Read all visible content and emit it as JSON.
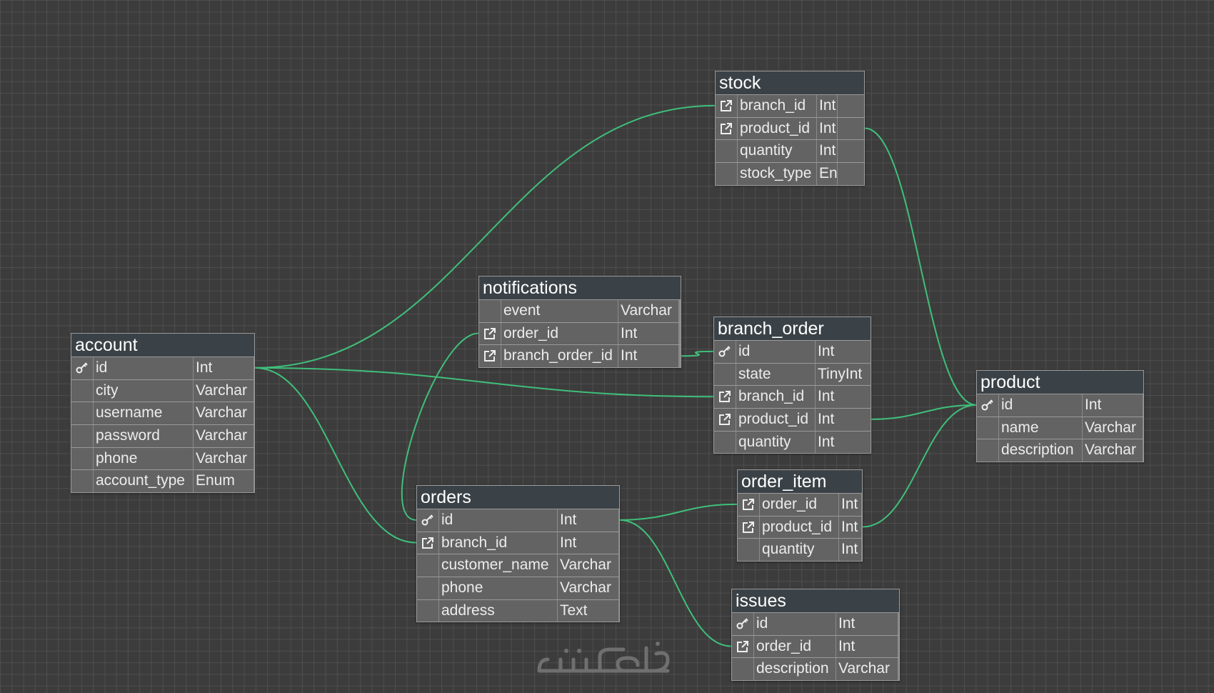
{
  "colors": {
    "link": "#3fbf7a",
    "header": "#3b4247",
    "cell": "#636363",
    "background": "#3c3c3c"
  },
  "watermark": {
    "text": "خمسات"
  },
  "tables": [
    {
      "id": "stock",
      "title": "stock",
      "rows": [
        {
          "icon": "foreign-key-icon",
          "name": "branch_id",
          "type": "Int"
        },
        {
          "icon": "foreign-key-icon",
          "name": "product_id",
          "type": "Int"
        },
        {
          "icon": "",
          "name": "quantity",
          "type": "Int"
        },
        {
          "icon": "",
          "name": "stock_type",
          "type": "Enum"
        }
      ]
    },
    {
      "id": "notifications",
      "title": "notifications",
      "rows": [
        {
          "icon": "",
          "name": "event",
          "type": "Varchar"
        },
        {
          "icon": "foreign-key-icon",
          "name": "order_id",
          "type": "Int"
        },
        {
          "icon": "foreign-key-icon",
          "name": "branch_order_id",
          "type": "Int"
        }
      ]
    },
    {
      "id": "branch_order",
      "title": "branch_order",
      "rows": [
        {
          "icon": "primary-key-icon",
          "name": "id",
          "type": "Int"
        },
        {
          "icon": "",
          "name": "state",
          "type": "TinyInt"
        },
        {
          "icon": "foreign-key-icon",
          "name": "branch_id",
          "type": "Int"
        },
        {
          "icon": "foreign-key-icon",
          "name": "product_id",
          "type": "Int"
        },
        {
          "icon": "",
          "name": "quantity",
          "type": "Int"
        }
      ]
    },
    {
      "id": "account",
      "title": "account",
      "rows": [
        {
          "icon": "primary-key-icon",
          "name": "id",
          "type": "Int"
        },
        {
          "icon": "",
          "name": "city",
          "type": "Varchar"
        },
        {
          "icon": "",
          "name": "username",
          "type": "Varchar"
        },
        {
          "icon": "",
          "name": "password",
          "type": "Varchar"
        },
        {
          "icon": "",
          "name": "phone",
          "type": "Varchar"
        },
        {
          "icon": "",
          "name": "account_type",
          "type": "Enum"
        }
      ]
    },
    {
      "id": "product",
      "title": "product",
      "rows": [
        {
          "icon": "primary-key-icon",
          "name": "id",
          "type": "Int"
        },
        {
          "icon": "",
          "name": "name",
          "type": "Varchar"
        },
        {
          "icon": "",
          "name": "description",
          "type": "Varchar"
        }
      ]
    },
    {
      "id": "order_item",
      "title": "order_item",
      "rows": [
        {
          "icon": "foreign-key-icon",
          "name": "order_id",
          "type": "Int"
        },
        {
          "icon": "foreign-key-icon",
          "name": "product_id",
          "type": "Int"
        },
        {
          "icon": "",
          "name": "quantity",
          "type": "Int"
        }
      ]
    },
    {
      "id": "orders",
      "title": "orders",
      "rows": [
        {
          "icon": "primary-key-icon",
          "name": "id",
          "type": "Int"
        },
        {
          "icon": "foreign-key-icon",
          "name": "branch_id",
          "type": "Int"
        },
        {
          "icon": "",
          "name": "customer_name",
          "type": "Varchar"
        },
        {
          "icon": "",
          "name": "phone",
          "type": "Varchar"
        },
        {
          "icon": "",
          "name": "address",
          "type": "Text"
        }
      ]
    },
    {
      "id": "issues",
      "title": "issues",
      "rows": [
        {
          "icon": "primary-key-icon",
          "name": "id",
          "type": "Int"
        },
        {
          "icon": "foreign-key-icon",
          "name": "order_id",
          "type": "Int"
        },
        {
          "icon": "",
          "name": "description",
          "type": "Varchar"
        }
      ]
    }
  ],
  "relations": [
    {
      "from_table": "stock",
      "from_row": 0,
      "to_table": "account",
      "to_row": 0
    },
    {
      "from_table": "stock",
      "from_row": 1,
      "to_table": "product",
      "to_row": 0
    },
    {
      "from_table": "notifications",
      "from_row": 1,
      "to_table": "orders",
      "to_row": 0
    },
    {
      "from_table": "notifications",
      "from_row": 2,
      "to_table": "branch_order",
      "to_row": 0
    },
    {
      "from_table": "branch_order",
      "from_row": 2,
      "to_table": "account",
      "to_row": 0
    },
    {
      "from_table": "branch_order",
      "from_row": 3,
      "to_table": "product",
      "to_row": 0
    },
    {
      "from_table": "orders",
      "from_row": 1,
      "to_table": "account",
      "to_row": 0
    },
    {
      "from_table": "order_item",
      "from_row": 0,
      "to_table": "orders",
      "to_row": 0
    },
    {
      "from_table": "order_item",
      "from_row": 1,
      "to_table": "product",
      "to_row": 0
    },
    {
      "from_table": "issues",
      "from_row": 1,
      "to_table": "orders",
      "to_row": 0
    }
  ]
}
